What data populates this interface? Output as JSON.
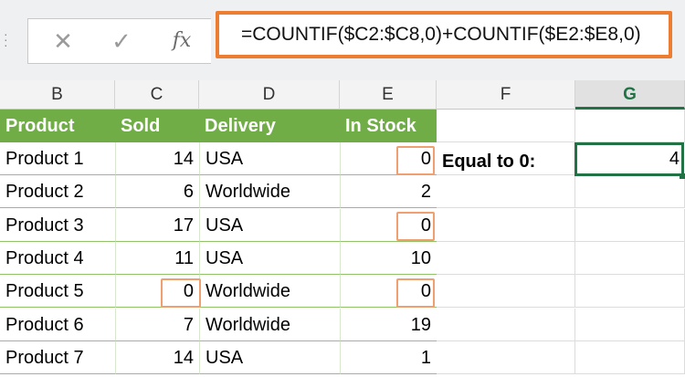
{
  "formula_bar": {
    "cancel_icon": "✕",
    "enter_icon": "✓",
    "fx_label": "fx",
    "formula": "=COUNTIF($C2:$C8,0)+COUNTIF($E2:$E8,0)"
  },
  "columns": [
    "B",
    "C",
    "D",
    "E",
    "F",
    "G"
  ],
  "selected_column": "G",
  "table": {
    "headers": [
      "Product",
      "Sold",
      "Delivery",
      "In Stock"
    ],
    "rows": [
      {
        "product": "Product 1",
        "sold": "14",
        "delivery": "USA",
        "stock": "0"
      },
      {
        "product": "Product 2",
        "sold": "6",
        "delivery": "Worldwide",
        "stock": "2"
      },
      {
        "product": "Product 3",
        "sold": "17",
        "delivery": "USA",
        "stock": "0"
      },
      {
        "product": "Product 4",
        "sold": "11",
        "delivery": "USA",
        "stock": "10"
      },
      {
        "product": "Product 5",
        "sold": "0",
        "delivery": "Worldwide",
        "stock": "0"
      },
      {
        "product": "Product 6",
        "sold": "7",
        "delivery": "Worldwide",
        "stock": "19"
      },
      {
        "product": "Product 7",
        "sold": "14",
        "delivery": "USA",
        "stock": "1"
      }
    ]
  },
  "result": {
    "label": "Equal to 0:",
    "value": "4"
  },
  "colors": {
    "header_green": "#70ad47",
    "accent_orange": "#ed7d31",
    "excel_green": "#217346"
  }
}
